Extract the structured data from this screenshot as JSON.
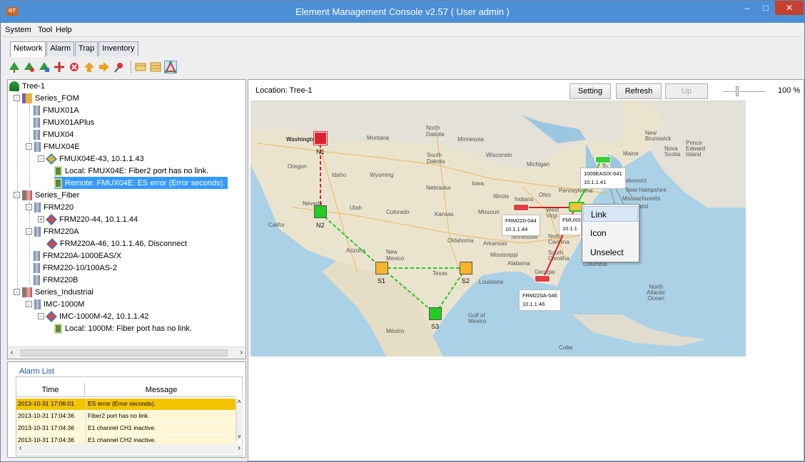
{
  "window": {
    "title": "Element Management Console v2.57 ( User admin )",
    "app_icon_text": "GT"
  },
  "menu": [
    "System",
    "Tool",
    "Help"
  ],
  "tabs": [
    "Network",
    "Alarm",
    "Trap",
    "Inventory"
  ],
  "tree": [
    {
      "label": "Tree-1",
      "icon": "tree-root-icon"
    },
    {
      "label": "Series_FOM",
      "icon": "series-folder-icon"
    },
    {
      "label": "FMUX01A",
      "icon": "device-icon"
    },
    {
      "label": "FMUX01APlus",
      "icon": "device-icon"
    },
    {
      "label": "FMUX04",
      "icon": "device-icon"
    },
    {
      "label": "FMUX04E",
      "icon": "device-icon"
    },
    {
      "label": "FMUX04E-43, 10.1.1.43",
      "icon": "node-icon"
    },
    {
      "label": "Local: FMUX04E: Fiber2 port has no link.",
      "icon": "alarm-port-icon"
    },
    {
      "label": "Remote: FMUX04E: ES error (Error seconds).",
      "icon": "alarm-port-icon"
    },
    {
      "label": "Series_Fiber",
      "icon": "series-folder-icon"
    },
    {
      "label": "FRM220",
      "icon": "device-icon"
    },
    {
      "label": "FRM220-44, 10.1.1.44",
      "icon": "node-icon"
    },
    {
      "label": "FRM220A",
      "icon": "device-icon"
    },
    {
      "label": "FRM220A-46, 10.1.1.46, Disconnect",
      "icon": "node-icon"
    },
    {
      "label": "FRM220A-1000EAS/X",
      "icon": "device-icon"
    },
    {
      "label": "FRM220-10/100AS-2",
      "icon": "device-icon"
    },
    {
      "label": "FRM220B",
      "icon": "device-icon"
    },
    {
      "label": "Series_Industrial",
      "icon": "series-folder-icon"
    },
    {
      "label": "IMC-1000M",
      "icon": "device-icon"
    },
    {
      "label": "IMC-1000M-42, 10.1.1.42",
      "icon": "node-icon"
    },
    {
      "label": "Local: 1000M: Fiber port has no link.",
      "icon": "alarm-port-icon"
    }
  ],
  "alarm": {
    "title": "Alarm List",
    "columns": [
      "Time",
      "Message"
    ],
    "rows": [
      {
        "time": "2013-10-31 17:06:01",
        "message": "ES error (Error seconds)."
      },
      {
        "time": "2013-10-31 17:04:36",
        "message": "Fiber2 port has no link."
      },
      {
        "time": "2013-10-31 17:04:36",
        "message": "E1 channel CH1 inactive."
      },
      {
        "time": "2013-10-31 17:04:36",
        "message": "E1 channel CH2 inactive."
      }
    ]
  },
  "topology": {
    "location": "Location: Tree-1",
    "buttons": {
      "setting": "Setting",
      "refresh": "Refresh",
      "up": "Up"
    },
    "zoom": "100 %",
    "nodes": {
      "n1": "N1",
      "n2": "N2",
      "s1": "S1",
      "s2": "S2",
      "s3": "S3"
    },
    "devices": {
      "frm220_044": {
        "name": "FRM220-044",
        "ip": "10.1.1.44"
      },
      "eas_041": {
        "name": "1000EAS/X-041",
        "ip": "10.1.1.41"
      },
      "frm220a_046": {
        "name": "FRM220A-046",
        "ip": "10.1.1.46"
      },
      "fmux_partial": {
        "name": "FMUX0",
        "ip": "10.1.1"
      }
    },
    "map_labels": {
      "washington": "Washington",
      "oregon": "Oregon",
      "idaho": "Idaho",
      "montana": "Montana",
      "wyoming": "Wyoming",
      "nevada": "Nevada",
      "utah": "Utah",
      "colorado": "Colorado",
      "california": "Califor",
      "arizona": "Arizona",
      "new_mexico": "New\nMexico",
      "north_dakota": "North\nDakota",
      "south_dakota": "South\nDakota",
      "nebraska": "Nebraska",
      "kansas": "Kansas",
      "oklahoma": "Oklahoma",
      "texas": "Texas",
      "minnesota": "Minnesota",
      "iowa": "Iowa",
      "missouri": "Missouri",
      "arkansas": "Arkansas",
      "louisiana": "Louisiana",
      "wisconsin": "Wisconsin",
      "michigan": "Michigan",
      "illinois": "Illinois",
      "indiana": "Indiana",
      "ohio": "Ohio",
      "mississippi": "Mississippi",
      "alabama": "Alabama",
      "georgia": "Georgia",
      "tennessee": "Tennessee",
      "pennsylvania": "Pennsylvania",
      "new_brunswick": "New\nBrunswick",
      "maine": "Maine",
      "nova_scotia": "Nova\nScotia",
      "pei": "Prince\nEdward\nIsland",
      "vermont": "Vermont",
      "new_hampshire": "New Hampshire",
      "massachusetts": "Massachusetts",
      "rhode_island": "Rhode Island",
      "south_carolina": "South\nCarolina",
      "north_carolina": "North\nCarolina",
      "columbia": "Columbia",
      "gulf": "Gulf of\nMexico",
      "atlantic": "North\nAtlantic\nOcean",
      "mexico": "México",
      "cuba": "Cuba",
      "west_virginia": "West\nVirgi",
      "jersey": "sey",
      "connecticut": "ut"
    },
    "context_menu": [
      "Link",
      "Icon",
      "Unselect"
    ]
  }
}
